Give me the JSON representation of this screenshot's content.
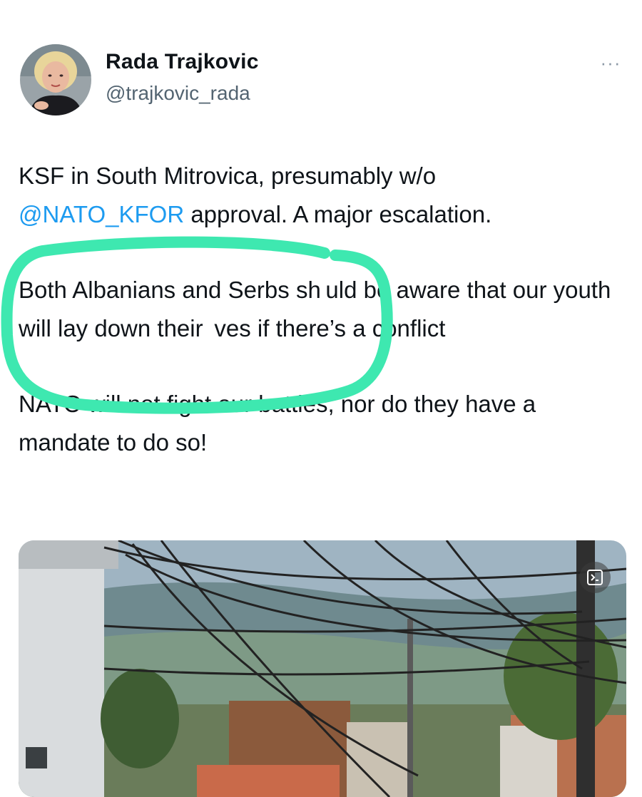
{
  "author": {
    "name": "Rada Trajkovic",
    "handle": "@trajkovic_rada"
  },
  "menu": {
    "more_label": "···"
  },
  "tweet": {
    "line1_text": "KSF in South Mitrovica, presumably w/o",
    "mention": "@NATO_KFOR",
    "line2_rest": " approval. A major escalation.",
    "paragraph2": "Both Albanians and Serbs sh uld be aware that our youth will lay down their  ves if there’s a conflict",
    "paragraph3": "NATO will not fight our battles, nor do they have a mandate to do so!"
  },
  "colors": {
    "mention": "#1d9bf0",
    "highlight_ring": "#3ee8b0",
    "handle": "#536471"
  },
  "icons": {
    "more": "more-horizontal-icon",
    "media_badge": "gif-icon"
  }
}
